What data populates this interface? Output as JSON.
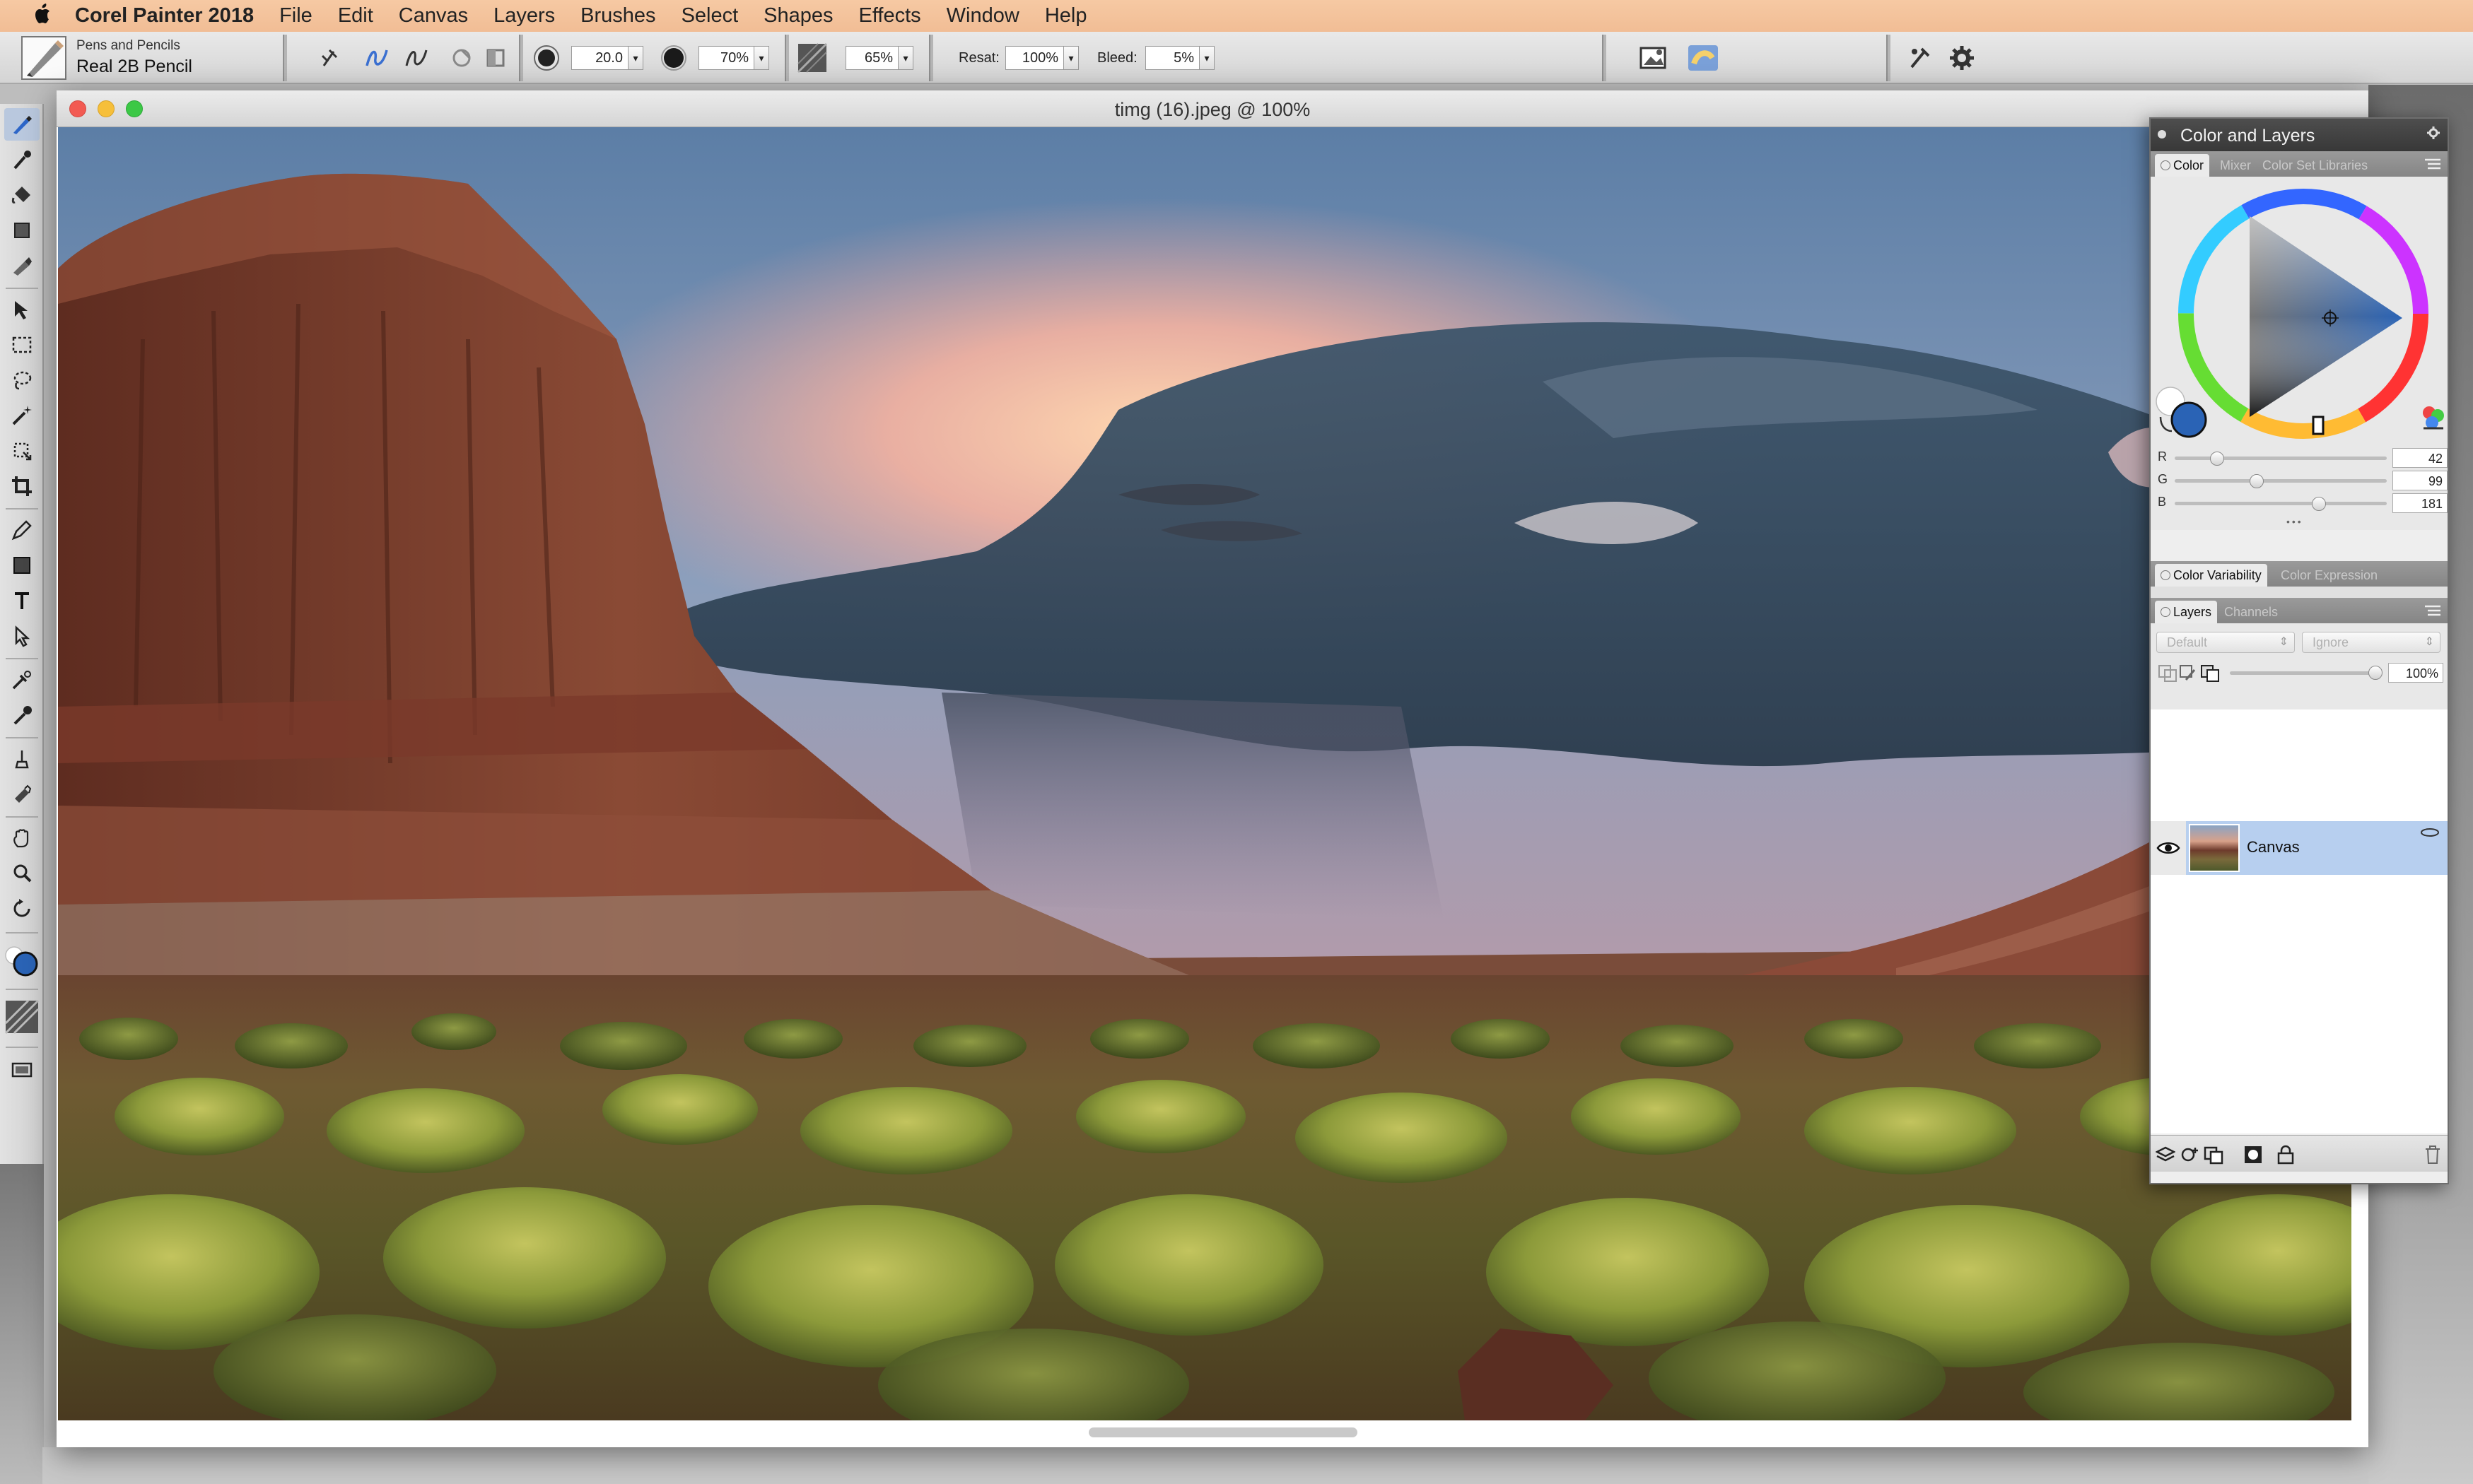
{
  "menubar": {
    "app_name": "Corel Painter 2018",
    "menus": [
      "File",
      "Edit",
      "Canvas",
      "Layers",
      "Brushes",
      "Select",
      "Shapes",
      "Effects",
      "Window",
      "Help"
    ]
  },
  "property_bar": {
    "brush_category": "Pens and Pencils",
    "brush_variant": "Real 2B Pencil",
    "size_value": "20.0",
    "opacity_value": "70%",
    "grain_value": "65%",
    "resat_label": "Resat:",
    "resat_value": "100%",
    "bleed_label": "Bleed:",
    "bleed_value": "5%"
  },
  "document": {
    "title": "timg (16).jpeg @ 100%"
  },
  "panel": {
    "title": "Color and Layers",
    "color_tabs": [
      "Color",
      "Mixer",
      "Color Set Libraries"
    ],
    "rgb": [
      {
        "label": "R",
        "value": "42"
      },
      {
        "label": "G",
        "value": "99"
      },
      {
        "label": "B",
        "value": "181"
      }
    ],
    "variability_tabs": [
      "Color Variability",
      "Color Expression"
    ],
    "layers_tabs": [
      "Layers",
      "Channels"
    ],
    "composite_method": "Default",
    "composite_depth": "Ignore",
    "opacity_value": "100%",
    "layer_name": "Canvas"
  },
  "colors": {
    "main_color": "#2a63b5",
    "accent": "#b7cfef"
  },
  "icons": {
    "toolbox": [
      "brush-icon",
      "dropper-icon",
      "paint-bucket-icon",
      "eraser-icon",
      "blender-icon",
      "layer-adjuster-icon",
      "rect-select-icon",
      "lasso-icon",
      "magic-wand-icon",
      "transform-icon",
      "crop-icon",
      "pen-icon",
      "shape-icon",
      "text-icon",
      "selection-adjuster-icon",
      "cloner-icon",
      "rubber-stamp-icon",
      "dodge-icon",
      "burn-icon",
      "grabber-icon",
      "magnifier-icon",
      "rotate-page-icon"
    ]
  }
}
